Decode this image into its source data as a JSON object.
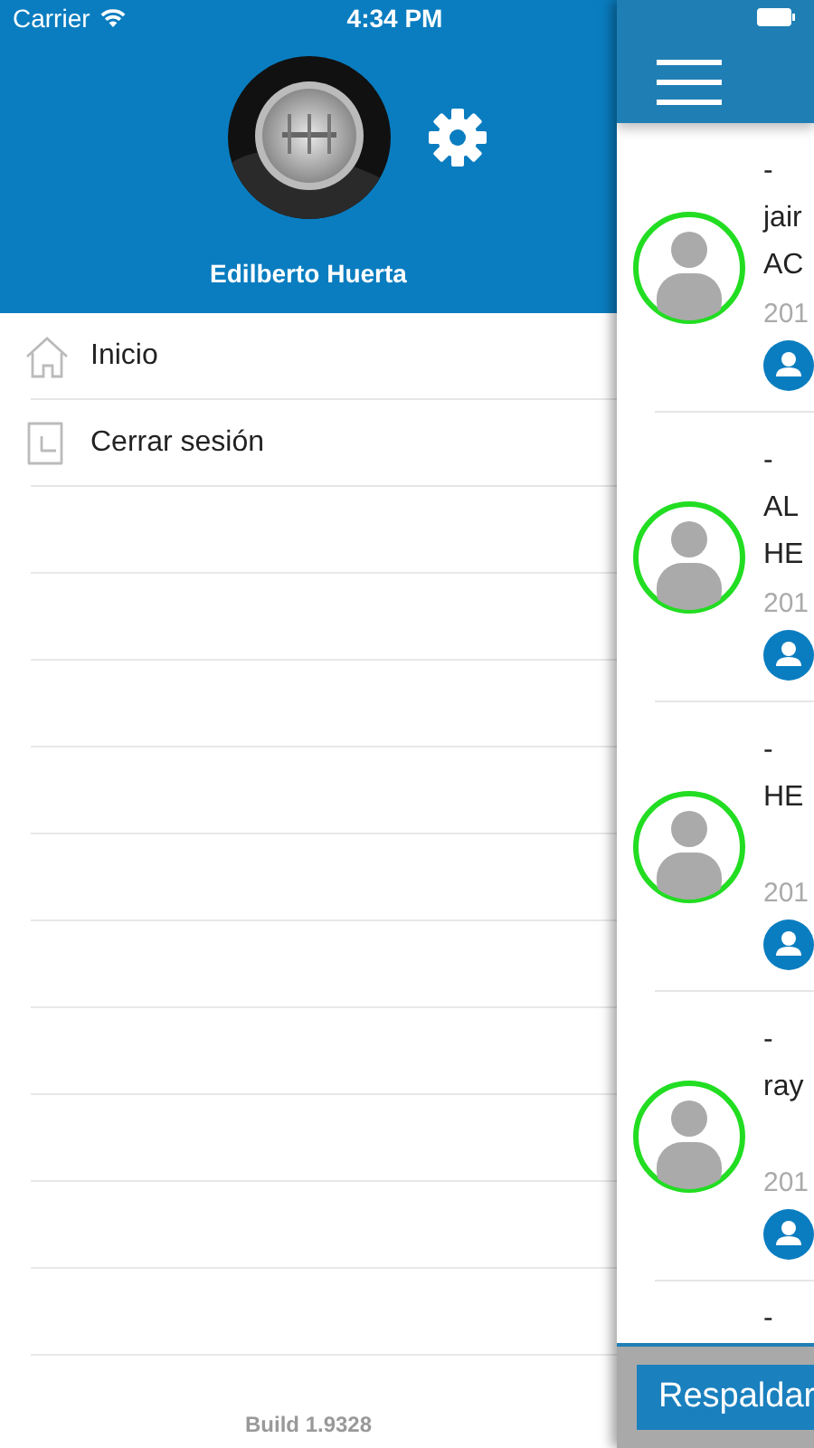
{
  "status_bar": {
    "carrier": "Carrier",
    "time": "4:34 PM"
  },
  "profile": {
    "name": "Edilberto Huerta"
  },
  "menu": [
    {
      "label": "Inicio",
      "kind": "home"
    },
    {
      "label": "Cerrar sesión",
      "kind": "logout"
    }
  ],
  "build": "Build 1.9328",
  "feed": [
    {
      "title": "-",
      "line_1": "jair",
      "line_2": "AC",
      "date": "201"
    },
    {
      "title": "-",
      "line_1": "AL",
      "line_2": "HE",
      "date": "201"
    },
    {
      "title": "-",
      "line_1": "HE",
      "date": "201"
    },
    {
      "title": "-",
      "line_1": "ray",
      "date": "201"
    }
  ],
  "trailing_item": {
    "title": "-"
  },
  "backup_button": "Respaldar"
}
